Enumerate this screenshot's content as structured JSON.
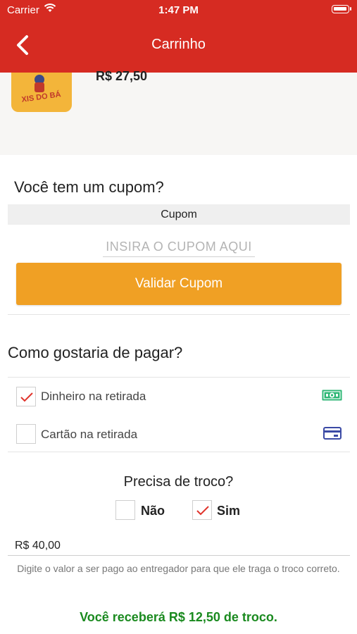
{
  "status_bar": {
    "carrier": "Carrier",
    "time": "1:47 PM"
  },
  "header": {
    "title": "Carrinho",
    "back_icon": "chevron-left-icon"
  },
  "cart_item": {
    "price": "R$ 27,50",
    "logo_text": "XIS DO BÁ"
  },
  "coupon": {
    "heading": "Você tem um cupom?",
    "section_label": "Cupom",
    "input_placeholder": "INSIRA O CUPOM AQUI",
    "input_value": "",
    "validate_label": "Validar Cupom",
    "button_color": "#f0a024"
  },
  "payment": {
    "heading": "Como gostaria de pagar?",
    "options": [
      {
        "label": "Dinheiro na retirada",
        "checked": true,
        "icon": "cash-icon"
      },
      {
        "label": "Cartão na retirada",
        "checked": false,
        "icon": "credit-card-icon"
      }
    ]
  },
  "change": {
    "question": "Precisa de troco?",
    "options": [
      {
        "label": "Não",
        "checked": false
      },
      {
        "label": "Sim",
        "checked": true
      }
    ],
    "amount_value": "R$ 40,00",
    "help_text": "Digite o valor a ser pago ao entregador para que ele traga o troco correto.",
    "result_text": "Você receberá R$ 12,50 de troco.",
    "result_color": "#1a8a1f"
  },
  "colors": {
    "header": "#d62b22",
    "check": "#e0342c"
  }
}
